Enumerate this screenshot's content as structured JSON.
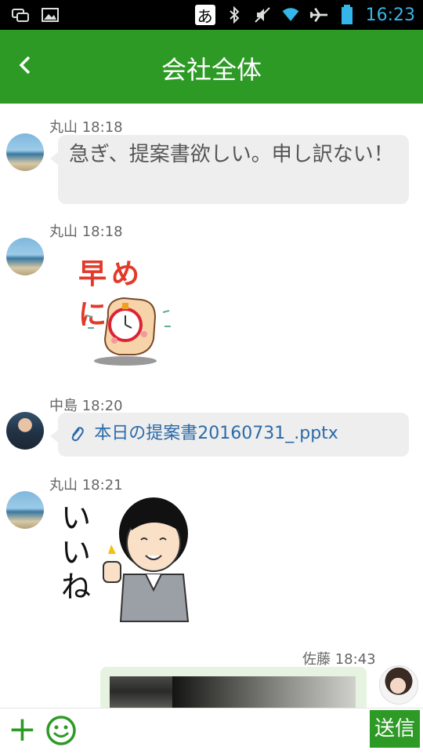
{
  "status_bar": {
    "ime": "あ",
    "time": "16:23",
    "icons": [
      "screen-cast-icon",
      "gallery-icon",
      "bluetooth-icon",
      "mute-icon",
      "wifi-icon",
      "airplane-icon",
      "battery-icon"
    ]
  },
  "header": {
    "title": "会社全体",
    "back_icon": "back-chevron-icon"
  },
  "messages": [
    {
      "sender": "丸山",
      "time": "18:18",
      "text": "急ぎ、提案書欲しい。申し訳ない！"
    },
    {
      "sender": "丸山",
      "time": "18:18",
      "sticker_text": "早めに！"
    },
    {
      "sender": "中島",
      "time": "18:20",
      "file": "本日の提案書20160731_.pptx"
    },
    {
      "sender": "丸山",
      "time": "18:21",
      "sticker_text": "いいね"
    },
    {
      "sender": "佐藤",
      "time": "18:43"
    }
  ],
  "input_bar": {
    "send_label": "送信",
    "placeholder": ""
  },
  "colors": {
    "accent": "#2d9a26",
    "bubble": "#eeeeee",
    "link": "#2b6aa8"
  }
}
